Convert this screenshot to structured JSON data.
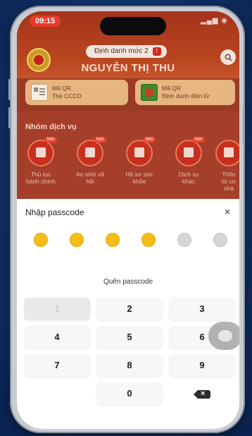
{
  "status_bar": {
    "time": "09:15"
  },
  "header": {
    "identification_level": "Định danh mức 2",
    "user_name": "NGUYỄN THỊ THU",
    "qr_cards": [
      {
        "line1": "Mã QR",
        "line2": "Thẻ CCCD"
      },
      {
        "line1": "Mã QR",
        "line2": "Định danh điện tử"
      }
    ]
  },
  "services": {
    "title": "Nhóm dịch vụ",
    "badge": "Mới",
    "items": [
      {
        "label_line1": "Thủ tục",
        "label_line2": "hành chính",
        "new": true
      },
      {
        "label_line1": "An sinh xã",
        "label_line2": "hội",
        "new": true
      },
      {
        "label_line1": "Hồ sơ sức",
        "label_line2": "khỏe",
        "new": true
      },
      {
        "label_line1": "Dịch vụ",
        "label_line2": "khác",
        "new": true
      },
      {
        "label_line1": "Thôn",
        "label_line2": "từ cơ",
        "label_line3": "nhà",
        "new": false
      }
    ]
  },
  "passcode_sheet": {
    "title": "Nhập passcode",
    "close_symbol": "×",
    "digits_entered": 4,
    "digits_total": 6,
    "forgot_label": "Quên passcode",
    "keys": [
      "1",
      "2",
      "3",
      "4",
      "5",
      "6",
      "7",
      "8",
      "9",
      "0"
    ]
  },
  "colors": {
    "brand_red": "#a3331c",
    "dot_filled": "#f5bd17",
    "dot_empty": "#d6d6d6"
  }
}
